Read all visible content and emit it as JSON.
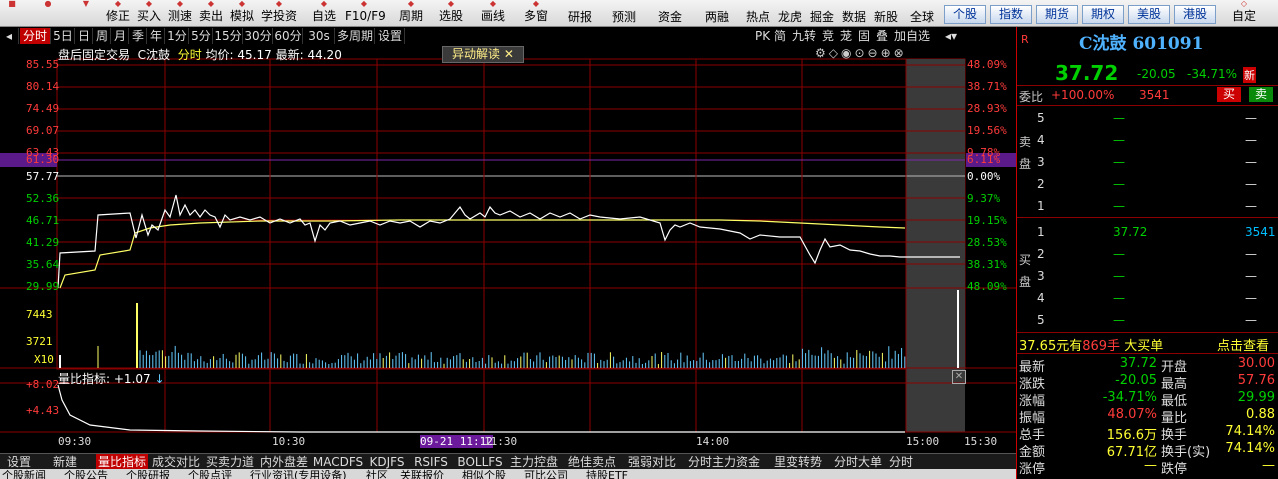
{
  "toolbar": {
    "items": [
      "修正",
      "买入",
      "测速",
      "卖出",
      "模拟",
      "学投资",
      "自选",
      "F10/F9",
      "周期",
      "选股",
      "画线",
      "多窗"
    ],
    "buttons": [
      "研报",
      "预测",
      "资金",
      "两融",
      "热点",
      "龙虎",
      "掘金",
      "数据",
      "新股",
      "全球"
    ],
    "tabs": [
      "个股",
      "指数",
      "期货",
      "期权",
      "美股",
      "港股"
    ],
    "custom": "自定"
  },
  "period_bar": {
    "items": [
      "分时",
      "5日",
      "日",
      "周",
      "月",
      "季",
      "年",
      "1分",
      "5分",
      "15分",
      "30分",
      "60分",
      "30s",
      "多周期",
      "设置"
    ],
    "active": "分时",
    "right_tools": [
      "PK",
      "简",
      "九转",
      "竞",
      "茏",
      "固",
      "叠",
      "加自选"
    ]
  },
  "info": {
    "mode": "盘后固定交易",
    "name": "C沈鼓",
    "label": "分时",
    "avg_label": "均价:",
    "avg": "45.17",
    "last_label": "最新:",
    "last": "44.20",
    "abnormal_btn": "异动解读"
  },
  "price_axis": {
    "left": [
      "85.55",
      "80.14",
      "74.49",
      "69.07",
      "63.43",
      "61.30",
      "57.77",
      "52.36",
      "46.71",
      "41.29",
      "35.64",
      "29.99"
    ],
    "right": [
      "48.09%",
      "38.71%",
      "28.93%",
      "19.56%",
      "9.78%",
      "6.11%",
      "0.00%",
      "9.37%",
      "19.15%",
      "28.53%",
      "38.31%",
      "48.09%"
    ]
  },
  "volume_axis": [
    "7443",
    "3721",
    "X10"
  ],
  "indicator": {
    "label": "量比指标:",
    "value": "+1.07",
    "axis": [
      "+8.02",
      "+4.43"
    ]
  },
  "time_axis": [
    "09:30",
    "10:30",
    "09-21 11:12",
    "11:30",
    "14:00",
    "15:00",
    "15:30"
  ],
  "right_panel": {
    "flag": "R",
    "stock": "C沈鼓 601091",
    "price": "37.72",
    "change": "-20.05",
    "pct": "-34.71%",
    "new_tag": "新",
    "ratio_label": "委比",
    "ratio": "+100.00%",
    "ratio_qty": "3541",
    "buy_btn": "买",
    "sell_btn": "卖",
    "sell_label": "卖盘",
    "buy_label": "买盘",
    "sell_levels": [
      {
        "n": "5",
        "p": "—",
        "v": "—"
      },
      {
        "n": "4",
        "p": "—",
        "v": "—"
      },
      {
        "n": "3",
        "p": "—",
        "v": "—"
      },
      {
        "n": "2",
        "p": "—",
        "v": "—"
      },
      {
        "n": "1",
        "p": "—",
        "v": "—"
      }
    ],
    "buy_levels": [
      {
        "n": "1",
        "p": "37.72",
        "v": "3541"
      },
      {
        "n": "2",
        "p": "—",
        "v": "—"
      },
      {
        "n": "3",
        "p": "—",
        "v": "—"
      },
      {
        "n": "4",
        "p": "—",
        "v": "—"
      },
      {
        "n": "5",
        "p": "—",
        "v": "—"
      }
    ],
    "big_order": {
      "amount": "37.65元有",
      "qty": "869手",
      "text": "大买单",
      "link": "点击查看"
    },
    "stats": [
      {
        "k1": "最新",
        "v1": "37.72",
        "k2": "开盘",
        "v2": "30.00"
      },
      {
        "k1": "涨跌",
        "v1": "-20.05",
        "k2": "最高",
        "v2": "57.76"
      },
      {
        "k1": "涨幅",
        "v1": "-34.71%",
        "k2": "最低",
        "v2": "29.99"
      },
      {
        "k1": "振幅",
        "v1": "48.07%",
        "k2": "量比",
        "v2": "0.88"
      },
      {
        "k1": "总手",
        "v1": "156.6万",
        "k2": "换手",
        "v2": "74.14%"
      },
      {
        "k1": "金额",
        "v1": "67.71亿",
        "k2": "换手(实)",
        "v2": "74.14%"
      },
      {
        "k1": "涨停",
        "v1": "—",
        "k2": "跌停",
        "v2": "—"
      }
    ]
  },
  "bottom_tabs": [
    "设置",
    "新建",
    "量比指标",
    "成交对比",
    "买卖力道",
    "内外盘差",
    "MACDFS",
    "KDJFS",
    "RSIFS",
    "BOLLFS",
    "主力控盘",
    "绝佳卖点",
    "强弱对比",
    "分时主力资金",
    "里变转势",
    "分时大单",
    "分时"
  ],
  "bottom_tabs_active": "量比指标",
  "news_tabs": [
    "个股新闻",
    "个股公告",
    "个股研报",
    "个股点评",
    "行业资讯(专用设备)",
    "社区",
    "关联报价",
    "相似个股",
    "可比公司",
    "持股ETF"
  ],
  "colors": {
    "up": "#ff3b3b",
    "down": "#00d000",
    "grid": "#8b0000",
    "price_line": "#ffffff",
    "avg_line": "#ffff66",
    "volume": "#66ccff"
  }
}
